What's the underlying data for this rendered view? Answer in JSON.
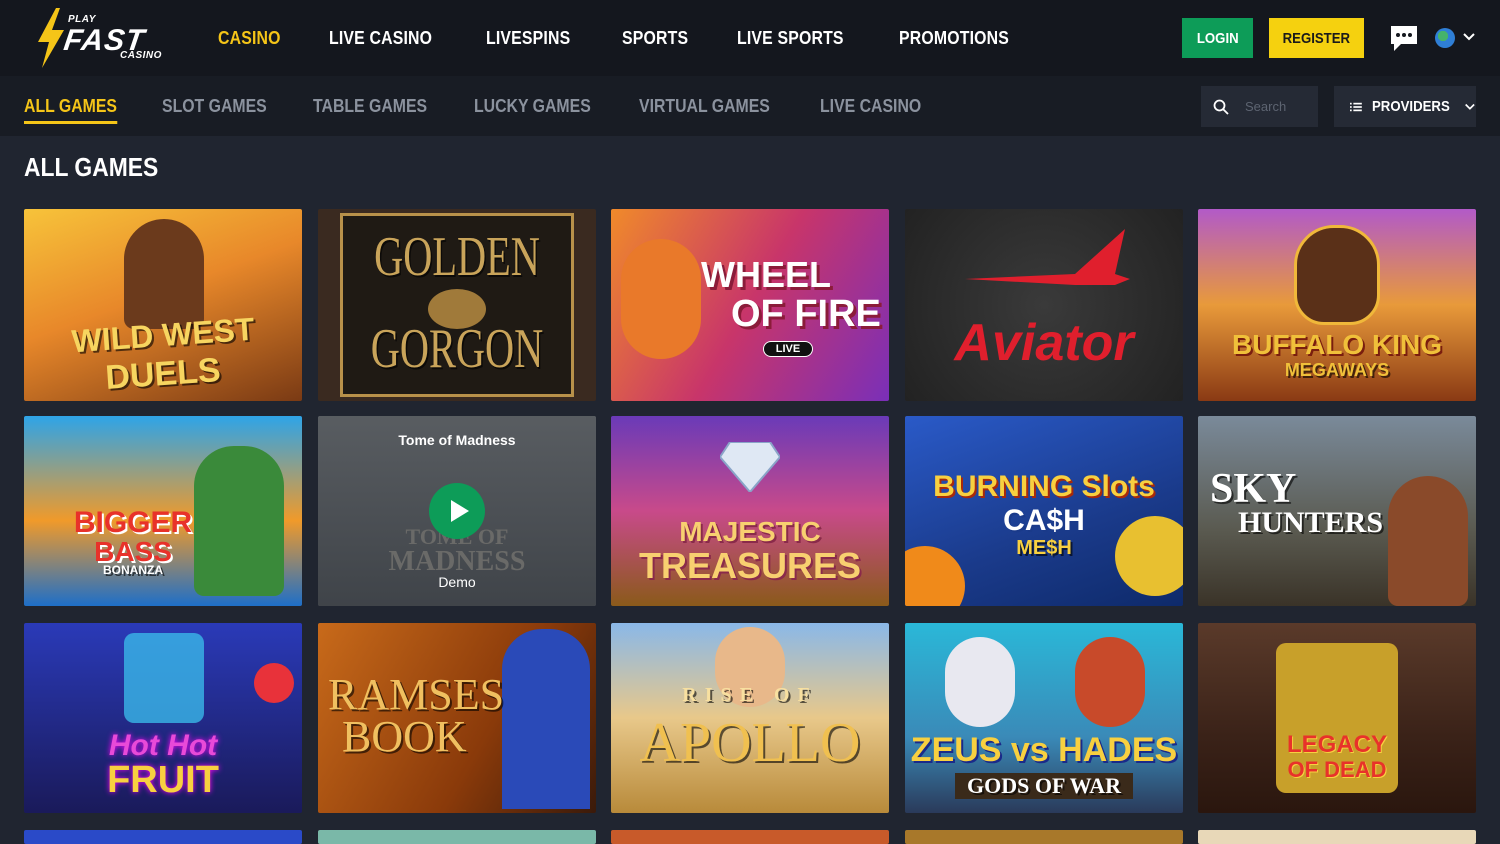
{
  "brand": {
    "play": "PLAY",
    "fast": "FAST",
    "casino": "CASINO"
  },
  "colors": {
    "accent": "#f5c518",
    "login": "#0d9c58",
    "register": "#f5d10f",
    "bg": "#202530",
    "header": "#14171e"
  },
  "main_nav": [
    {
      "label": "CASINO",
      "active": true
    },
    {
      "label": "LIVE CASINO"
    },
    {
      "label": "LIVESPINS"
    },
    {
      "label": "SPORTS"
    },
    {
      "label": "LIVE SPORTS"
    },
    {
      "label": "PROMOTIONS"
    }
  ],
  "auth": {
    "login": "LOGIN",
    "register": "REGISTER"
  },
  "header_icons": {
    "chat": "chat-icon",
    "language": "globe-icon"
  },
  "sub_nav": [
    {
      "label": "ALL GAMES",
      "active": true
    },
    {
      "label": "SLOT GAMES"
    },
    {
      "label": "TABLE GAMES"
    },
    {
      "label": "LUCKY GAMES"
    },
    {
      "label": "VIRTUAL GAMES"
    },
    {
      "label": "LIVE CASINO"
    }
  ],
  "search": {
    "placeholder": "Search",
    "icon": "search-icon"
  },
  "providers": {
    "label": "PROVIDERS",
    "icon": "list-icon"
  },
  "section_title": "ALL GAMES",
  "games": [
    {
      "name": "Wild West Duels",
      "line1": "WILD WEST",
      "line2": "DUELS"
    },
    {
      "name": "Golden Gorgon",
      "line1": "GOLDEN",
      "line2": "GORGON"
    },
    {
      "name": "Wheel of Fire",
      "line1": "WHEEL",
      "line2": "OF FIRE",
      "badge": "LIVE"
    },
    {
      "name": "Aviator",
      "line1": "Aviator",
      "line2": ""
    },
    {
      "name": "Buffalo King Megaways",
      "line1": "BUFFALO KING",
      "line2": "MEGAWAYS"
    },
    {
      "name": "Bigger Bass Bonanza",
      "line1": "BIGGER",
      "line2": "BASS",
      "line3": "BONANZA"
    },
    {
      "name": "Tome of Madness",
      "hover_title": "Tome of Madness",
      "line1": "TOME OF",
      "line2": "MADNESS",
      "demo": "Demo"
    },
    {
      "name": "Majestic Treasures",
      "line1": "MAJESTIC",
      "line2": "TREASURES"
    },
    {
      "name": "Burning Slots Cash Mesh",
      "line1": "BURNING Slots",
      "line2": "CA$H",
      "line3": "ME$H"
    },
    {
      "name": "Sky Hunters",
      "line1": "SKY",
      "line2": "HUNTERS"
    },
    {
      "name": "Hot Hot Fruit",
      "line1": "Hot Hot",
      "line2": "FRUIT"
    },
    {
      "name": "Ramses Book",
      "line1": "RAMSES",
      "line2": "BOOK"
    },
    {
      "name": "Rise of Apollo",
      "line1": "RISE OF",
      "line2": "APOLLO"
    },
    {
      "name": "Zeus vs Hades Gods of War",
      "line1": "ZEUS vs HADES",
      "line2": "GODS OF WAR"
    },
    {
      "name": "Legacy of Dead",
      "line1": "LEGACY",
      "line2": "OF DEAD"
    }
  ]
}
